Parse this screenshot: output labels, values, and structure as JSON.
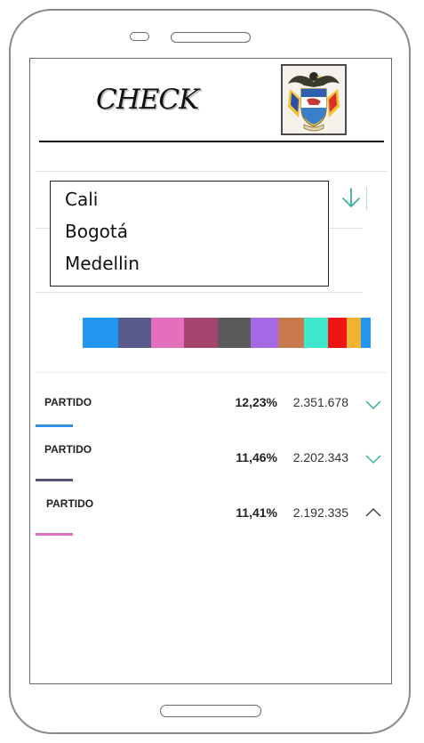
{
  "header": {
    "brand": "CHECK",
    "crest_icon": "colombia-coat-of-arms-icon"
  },
  "dropdown": {
    "open": true,
    "toggle_icon": "arrow-down-icon",
    "options": [
      "Cali",
      "Bogotá",
      "Medellin"
    ]
  },
  "distribution_bar": {
    "segments": [
      {
        "color": "#2196f3",
        "share": 12.3
      },
      {
        "color": "#575a8a",
        "share": 11.4
      },
      {
        "color": "#e46fbd",
        "share": 11.4
      },
      {
        "color": "#a8456e",
        "share": 11.4
      },
      {
        "color": "#5a5a5a",
        "share": 11.4
      },
      {
        "color": "#a569e6",
        "share": 9.7
      },
      {
        "color": "#c77a4e",
        "share": 8.9
      },
      {
        "color": "#3fe8cc",
        "share": 8.2
      },
      {
        "color": "#f01414",
        "share": 6.5
      },
      {
        "color": "#f2b233",
        "share": 4.9
      },
      {
        "color": "#2196f3",
        "share": 3.3
      }
    ]
  },
  "parties": [
    {
      "name": "PARTIDO",
      "percent": "12,23%",
      "votes": "2.351.678",
      "color": "#2f8fe0",
      "expanded": false
    },
    {
      "name": "PARTIDO",
      "percent": "11,46%",
      "votes": "2.202.343",
      "color": "#55557a",
      "expanded": false
    },
    {
      "name": "PARTIDO",
      "percent": "11,41%",
      "votes": "2.192.335",
      "color": "#e070c0",
      "expanded": true
    }
  ],
  "colors": {
    "accent": "#3aaea0",
    "divider": "#d7e6e1"
  }
}
